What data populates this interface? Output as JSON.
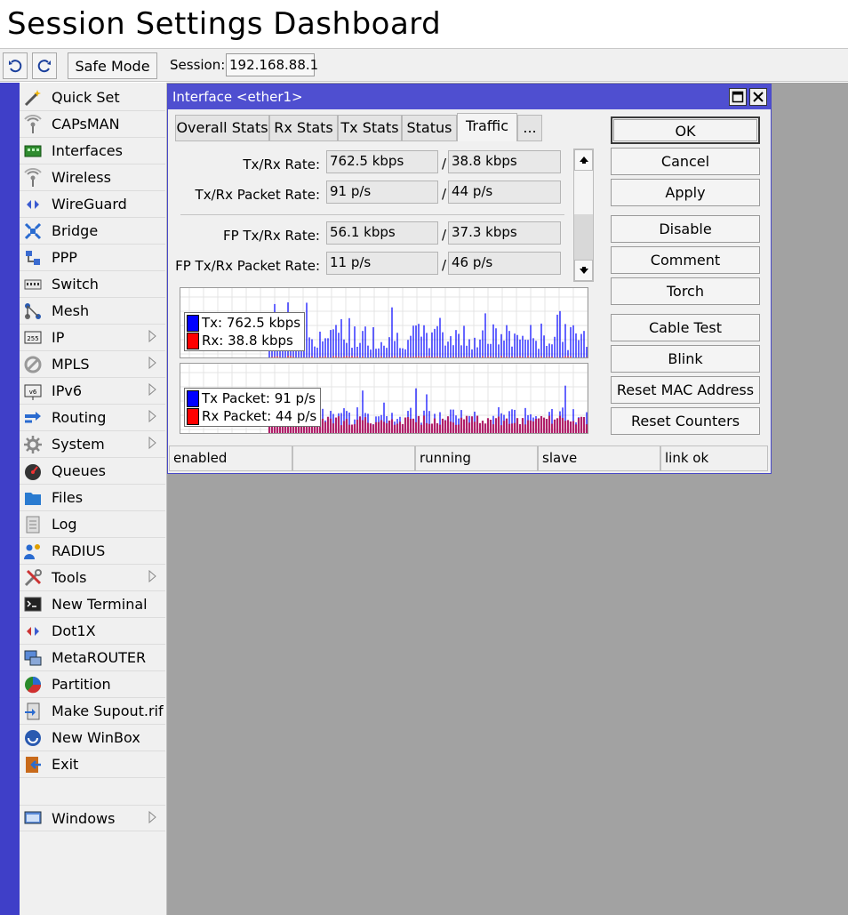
{
  "app": {
    "title": "Session Settings Dashboard"
  },
  "toolbar": {
    "undo_icon": "undo-arrow-icon",
    "redo_icon": "redo-arrow-icon",
    "safe_mode_label": "Safe Mode",
    "session_label": "Session:",
    "session_value": "192.168.88.1"
  },
  "sidebar": {
    "items": [
      {
        "label": "Quick Set",
        "icon": "wand-icon",
        "submenu": false
      },
      {
        "label": "CAPsMAN",
        "icon": "antenna-icon",
        "submenu": false
      },
      {
        "label": "Interfaces",
        "icon": "interfaces-icon",
        "submenu": false
      },
      {
        "label": "Wireless",
        "icon": "antenna-icon",
        "submenu": false
      },
      {
        "label": "WireGuard",
        "icon": "wireguard-icon",
        "submenu": false
      },
      {
        "label": "Bridge",
        "icon": "bridge-icon",
        "submenu": false
      },
      {
        "label": "PPP",
        "icon": "ppp-icon",
        "submenu": false
      },
      {
        "label": "Switch",
        "icon": "switch-icon",
        "submenu": false
      },
      {
        "label": "Mesh",
        "icon": "mesh-icon",
        "submenu": false
      },
      {
        "label": "IP",
        "icon": "ip-icon",
        "submenu": true
      },
      {
        "label": "MPLS",
        "icon": "mpls-icon",
        "submenu": true
      },
      {
        "label": "IPv6",
        "icon": "ipv6-icon",
        "submenu": true
      },
      {
        "label": "Routing",
        "icon": "routing-icon",
        "submenu": true
      },
      {
        "label": "System",
        "icon": "gear-icon",
        "submenu": true
      },
      {
        "label": "Queues",
        "icon": "queues-icon",
        "submenu": false
      },
      {
        "label": "Files",
        "icon": "folder-icon",
        "submenu": false
      },
      {
        "label": "Log",
        "icon": "log-icon",
        "submenu": false
      },
      {
        "label": "RADIUS",
        "icon": "radius-icon",
        "submenu": false
      },
      {
        "label": "Tools",
        "icon": "tools-icon",
        "submenu": true
      },
      {
        "label": "New Terminal",
        "icon": "terminal-icon",
        "submenu": false
      },
      {
        "label": "Dot1X",
        "icon": "dot1x-icon",
        "submenu": false
      },
      {
        "label": "MetaROUTER",
        "icon": "metarouter-icon",
        "submenu": false
      },
      {
        "label": "Partition",
        "icon": "partition-icon",
        "submenu": false
      },
      {
        "label": "Make Supout.rif",
        "icon": "supout-icon",
        "submenu": false
      },
      {
        "label": "New WinBox",
        "icon": "winbox-icon",
        "submenu": false
      },
      {
        "label": "Exit",
        "icon": "exit-icon",
        "submenu": false
      }
    ],
    "windows_item": {
      "label": "Windows",
      "icon": "windows-icon",
      "submenu": true
    }
  },
  "window": {
    "title": "Interface <ether1>",
    "tabs": [
      {
        "label": "Overall Stats",
        "active": false
      },
      {
        "label": "Rx Stats",
        "active": false
      },
      {
        "label": "Tx Stats",
        "active": false
      },
      {
        "label": "Status",
        "active": false
      },
      {
        "label": "Traffic",
        "active": true
      },
      {
        "label": "...",
        "active": false
      }
    ],
    "fields": [
      {
        "label": "Tx/Rx Rate:",
        "tx": "762.5 kbps",
        "rx": "38.8 kbps"
      },
      {
        "label": "Tx/Rx Packet Rate:",
        "tx": "91 p/s",
        "rx": "44 p/s"
      },
      {
        "label": "FP Tx/Rx Rate:",
        "tx": "56.1 kbps",
        "rx": "37.3 kbps"
      },
      {
        "label": "FP Tx/Rx Packet Rate:",
        "tx": "11 p/s",
        "rx": "46 p/s"
      }
    ],
    "separator": "/",
    "graphs": [
      {
        "legend": [
          {
            "label": "Tx:  762.5 kbps",
            "color": "#0000ff"
          },
          {
            "label": "Rx:  38.8 kbps",
            "color": "#ff0000"
          }
        ]
      },
      {
        "legend": [
          {
            "label": "Tx Packet:  91 p/s",
            "color": "#0000ff"
          },
          {
            "label": "Rx Packet:  44 p/s",
            "color": "#ff0000"
          }
        ]
      }
    ],
    "buttons": [
      "OK",
      "Cancel",
      "Apply",
      "Disable",
      "Comment",
      "Torch",
      "Cable Test",
      "Blink",
      "Reset MAC Address",
      "Reset Counters"
    ],
    "status": [
      "enabled",
      "",
      "running",
      "slave",
      "link ok"
    ]
  },
  "colors": {
    "accent_stripe": "#3f3fc8",
    "title_bar": "#4f4fd0",
    "desktop": "#a2a2a2",
    "tx": "#0000ff",
    "rx": "#ff0000"
  }
}
